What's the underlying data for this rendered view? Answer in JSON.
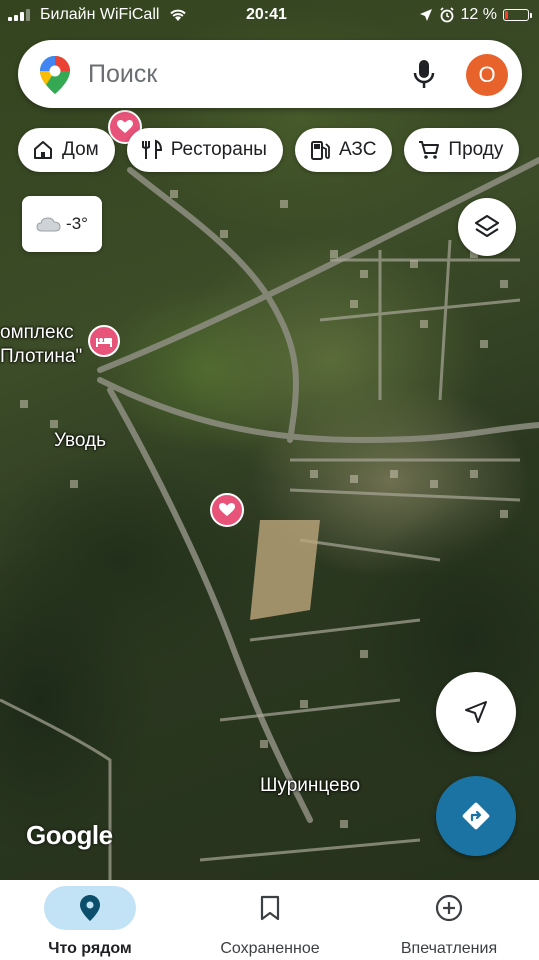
{
  "status_bar": {
    "carrier": "Билайн WiFiCall",
    "time": "20:41",
    "battery": "12 %"
  },
  "search": {
    "placeholder": "Поиск",
    "avatar_letter": "О"
  },
  "chips": [
    {
      "label": "Дом",
      "icon": "home-icon"
    },
    {
      "label": "Рестораны",
      "icon": "restaurant-icon"
    },
    {
      "label": "АЗС",
      "icon": "gas-station-icon"
    },
    {
      "label": "Проду",
      "icon": "cart-icon"
    }
  ],
  "weather": {
    "temperature": "-3°",
    "icon": "cloud-icon"
  },
  "map": {
    "labels": {
      "complex_line1": "омплекс",
      "complex_line2": "Плотина\"",
      "village1": "Уводь",
      "village2": "Шуринцево"
    },
    "attribution": "Google"
  },
  "bottom_nav": [
    {
      "label": "Что рядом",
      "icon": "location-pin-icon",
      "active": true
    },
    {
      "label": "Сохраненное",
      "icon": "bookmark-icon",
      "active": false
    },
    {
      "label": "Впечатления",
      "icon": "add-circle-icon",
      "active": false
    }
  ],
  "colors": {
    "accent": "#1a73a3",
    "avatar": "#e8622c",
    "saved_place": "#e8537a",
    "active_tab": "#c2e3f5"
  }
}
